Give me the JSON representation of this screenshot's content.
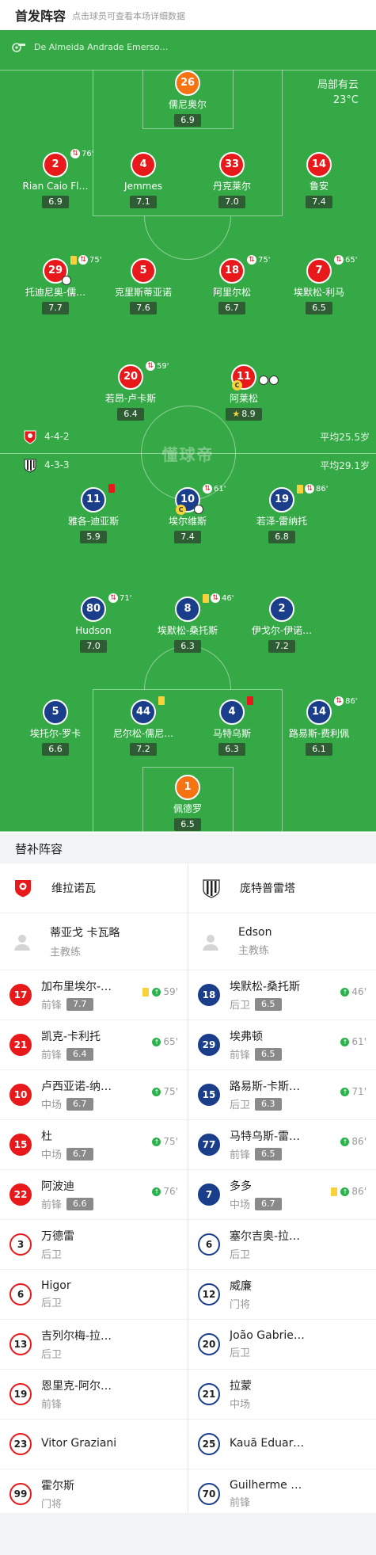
{
  "header": {
    "title": "首发阵容",
    "subtitle": "点击球员可查看本场详细数据"
  },
  "match": {
    "referee": "De Almeida Andrade Emerso…",
    "weather": "局部有云",
    "temperature": "23°C"
  },
  "home": {
    "formation": "4-4-2",
    "avg_age": "平均25.5岁",
    "color": "#e8191b"
  },
  "away": {
    "formation": "4-3-3",
    "avg_age": "平均29.1岁",
    "color": "#1a3e89"
  },
  "watermark": "懂球帝",
  "pitch_players": [
    {
      "num": "26",
      "name": "儒尼奥尔",
      "rating": "6.9",
      "team": "gk"
    },
    {
      "num": "2",
      "name": "Rian Caio Fl…",
      "rating": "6.9",
      "team": "home",
      "sub": "76'"
    },
    {
      "num": "4",
      "name": "Jemmes",
      "rating": "7.1",
      "team": "home"
    },
    {
      "num": "33",
      "name": "丹克莱尔",
      "rating": "7.0",
      "team": "home"
    },
    {
      "num": "14",
      "name": "鲁安",
      "rating": "7.4",
      "team": "home"
    },
    {
      "num": "29",
      "name": "托迪尼奥-儒…",
      "rating": "7.7",
      "team": "home",
      "sub": "75'",
      "yellow": true,
      "ball": true
    },
    {
      "num": "5",
      "name": "克里斯蒂亚诺",
      "rating": "7.6",
      "team": "home"
    },
    {
      "num": "18",
      "name": "阿里尔松",
      "rating": "6.7",
      "team": "home",
      "sub": "75'"
    },
    {
      "num": "7",
      "name": "埃默松-利马",
      "rating": "6.5",
      "team": "home",
      "sub": "65'"
    },
    {
      "num": "20",
      "name": "若昂-卢卡斯",
      "rating": "6.4",
      "team": "home",
      "sub": "59'"
    },
    {
      "num": "11",
      "name": "阿莱松",
      "rating": "8.9",
      "team": "home",
      "captain": true,
      "goals": 2,
      "star": true
    },
    {
      "num": "11",
      "name": "雅各-迪亚斯",
      "rating": "5.9",
      "team": "away",
      "red": true
    },
    {
      "num": "10",
      "name": "埃尔维斯",
      "rating": "7.4",
      "team": "away",
      "sub": "61'",
      "captain": true,
      "ball": true
    },
    {
      "num": "19",
      "name": "若泽-雷纳托",
      "rating": "6.8",
      "team": "away",
      "sub": "86'",
      "yellow": true
    },
    {
      "num": "80",
      "name": "Hudson",
      "rating": "7.0",
      "team": "away",
      "sub": "71'"
    },
    {
      "num": "8",
      "name": "埃默松-桑托斯",
      "rating": "6.3",
      "team": "away",
      "sub": "46'",
      "yellow": true
    },
    {
      "num": "2",
      "name": "伊戈尔-伊诺…",
      "rating": "7.2",
      "team": "away"
    },
    {
      "num": "5",
      "name": "埃托尔-罗卡",
      "rating": "6.6",
      "team": "away"
    },
    {
      "num": "44",
      "name": "尼尔松-儒尼…",
      "rating": "7.2",
      "team": "away",
      "yellow": true
    },
    {
      "num": "4",
      "name": "马特乌斯",
      "rating": "6.3",
      "team": "away",
      "red": true
    },
    {
      "num": "14",
      "name": "路易斯-费利佩",
      "rating": "6.1",
      "team": "away",
      "sub": "86'"
    },
    {
      "num": "1",
      "name": "佩德罗",
      "rating": "6.5",
      "team": "gk"
    }
  ],
  "subs_title": "替补阵容",
  "home_team": {
    "name": "维拉诺瓦",
    "coach": "蒂亚戈 卡瓦略",
    "coach_role": "主教练"
  },
  "away_team": {
    "name": "庞特普雷塔",
    "coach": "Edson",
    "coach_role": "主教练"
  },
  "home_subs": [
    {
      "num": "17",
      "name": "加布里埃尔-…",
      "pos": "前锋",
      "rating": "7.7",
      "time": "59'",
      "yellow": true,
      "in": true
    },
    {
      "num": "21",
      "name": "凯克-卡利托",
      "pos": "前锋",
      "rating": "6.4",
      "time": "65'",
      "in": true
    },
    {
      "num": "10",
      "name": "卢西亚诺-纳…",
      "pos": "中场",
      "rating": "6.7",
      "time": "75'",
      "in": true
    },
    {
      "num": "15",
      "name": "杜",
      "pos": "中场",
      "rating": "6.7",
      "time": "75'",
      "in": true
    },
    {
      "num": "22",
      "name": "阿波迪",
      "pos": "前锋",
      "rating": "6.6",
      "time": "76'",
      "in": true
    },
    {
      "num": "3",
      "name": "万德雷",
      "pos": "后卫"
    },
    {
      "num": "6",
      "name": "Higor",
      "pos": "后卫"
    },
    {
      "num": "13",
      "name": "吉列尔梅-拉…",
      "pos": "后卫"
    },
    {
      "num": "19",
      "name": "恩里克-阿尔…",
      "pos": "前锋"
    },
    {
      "num": "23",
      "name": "Vitor Graziani",
      "pos": ""
    },
    {
      "num": "99",
      "name": "霍尔斯",
      "pos": "门将"
    }
  ],
  "away_subs": [
    {
      "num": "18",
      "name": "埃默松-桑托斯",
      "pos": "后卫",
      "rating": "6.5",
      "time": "46'",
      "in": true
    },
    {
      "num": "29",
      "name": "埃弗顿",
      "pos": "前锋",
      "rating": "6.5",
      "time": "61'",
      "in": true
    },
    {
      "num": "15",
      "name": "路易斯-卡斯…",
      "pos": "后卫",
      "rating": "6.3",
      "time": "71'",
      "in": true
    },
    {
      "num": "77",
      "name": "马特乌斯-雷…",
      "pos": "前锋",
      "rating": "6.5",
      "time": "86'",
      "in": true
    },
    {
      "num": "7",
      "name": "多多",
      "pos": "中场",
      "rating": "6.7",
      "time": "86'",
      "yellow": true,
      "in": true
    },
    {
      "num": "6",
      "name": "塞尔吉奥-拉…",
      "pos": "后卫"
    },
    {
      "num": "12",
      "name": "威廉",
      "pos": "门将"
    },
    {
      "num": "20",
      "name": "João Gabriel …",
      "pos": "后卫"
    },
    {
      "num": "21",
      "name": "拉蒙",
      "pos": "中场"
    },
    {
      "num": "25",
      "name": "Kauã Eduard…",
      "pos": ""
    },
    {
      "num": "70",
      "name": "Guilherme Be…",
      "pos": "前锋"
    }
  ]
}
